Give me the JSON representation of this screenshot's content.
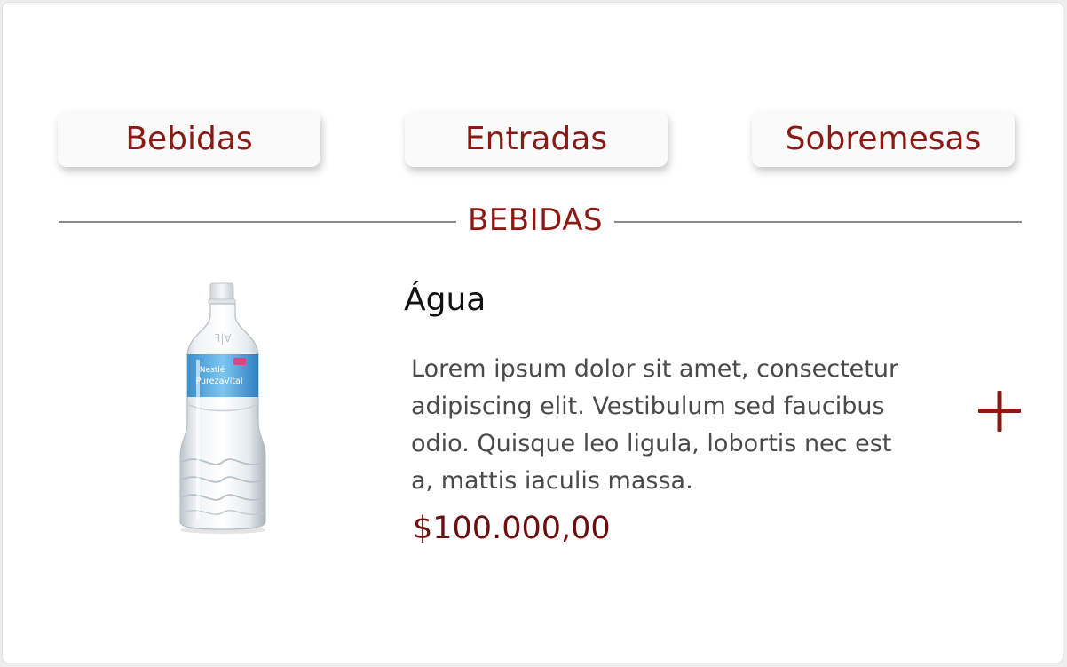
{
  "colors": {
    "accent": "#8b1a14",
    "price": "#6e0d0d",
    "divider": "#8a8a8a",
    "tab_bg": "#fafafa"
  },
  "tabs": [
    {
      "label": "Bebidas"
    },
    {
      "label": "Entradas"
    },
    {
      "label": "Sobremesas"
    }
  ],
  "section": {
    "title": "BEBIDAS"
  },
  "product": {
    "name": "Água",
    "description_lines": [
      "Lorem ipsum dolor sit amet, consectetur",
      "adipiscing elit. Vestibulum sed faucibus",
      "odio. Quisque leo ligula, lobortis nec est",
      "a, mattis iaculis massa."
    ],
    "price": "$100.000,00",
    "image_icon": "water-bottle-icon",
    "image_label": {
      "brand": "Nestlé",
      "line": "PurezaVital"
    }
  },
  "add_icon": "plus-icon"
}
